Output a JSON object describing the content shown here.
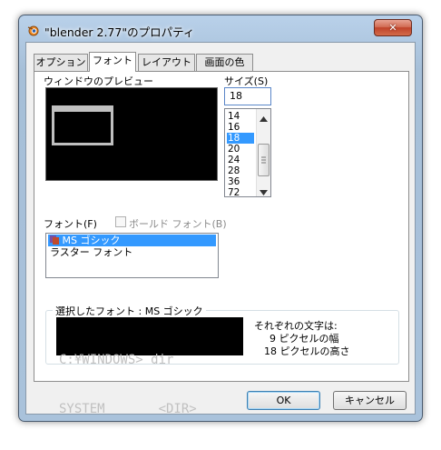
{
  "window": {
    "title": "\"blender 2.77\"のプロパティ",
    "close_glyph": "✕"
  },
  "tabs": [
    {
      "label": "オプション",
      "active": false
    },
    {
      "label": "フォント",
      "active": true
    },
    {
      "label": "レイアウト",
      "active": false
    },
    {
      "label": "画面の色",
      "active": false
    }
  ],
  "preview": {
    "label": "ウィンドウのプレビュー"
  },
  "size": {
    "label": "サイズ(S)",
    "value": "18",
    "options": [
      "14",
      "16",
      "18",
      "20",
      "24",
      "28",
      "36",
      "72"
    ],
    "selected": "18"
  },
  "font": {
    "label": "フォント(F)",
    "bold_label": "ボールド フォント(B)",
    "bold_checked": false,
    "options": [
      "MS ゴシック",
      "ラスター フォント"
    ],
    "selected": "MS ゴシック"
  },
  "selected_font": {
    "title": "選択したフォント : MS ゴシック",
    "sample_line1": "C:¥WINDOWS> dir",
    "sample_line2": "SYSTEM       <DIR>",
    "info_heading": "それぞれの文字は:",
    "info_width": "9 ピクセルの幅",
    "info_height": "18 ピクセルの高さ"
  },
  "buttons": {
    "ok": "OK",
    "cancel": "キャンセル"
  },
  "colors": {
    "selection": "#3399ff",
    "close_button": "#c0432a"
  }
}
